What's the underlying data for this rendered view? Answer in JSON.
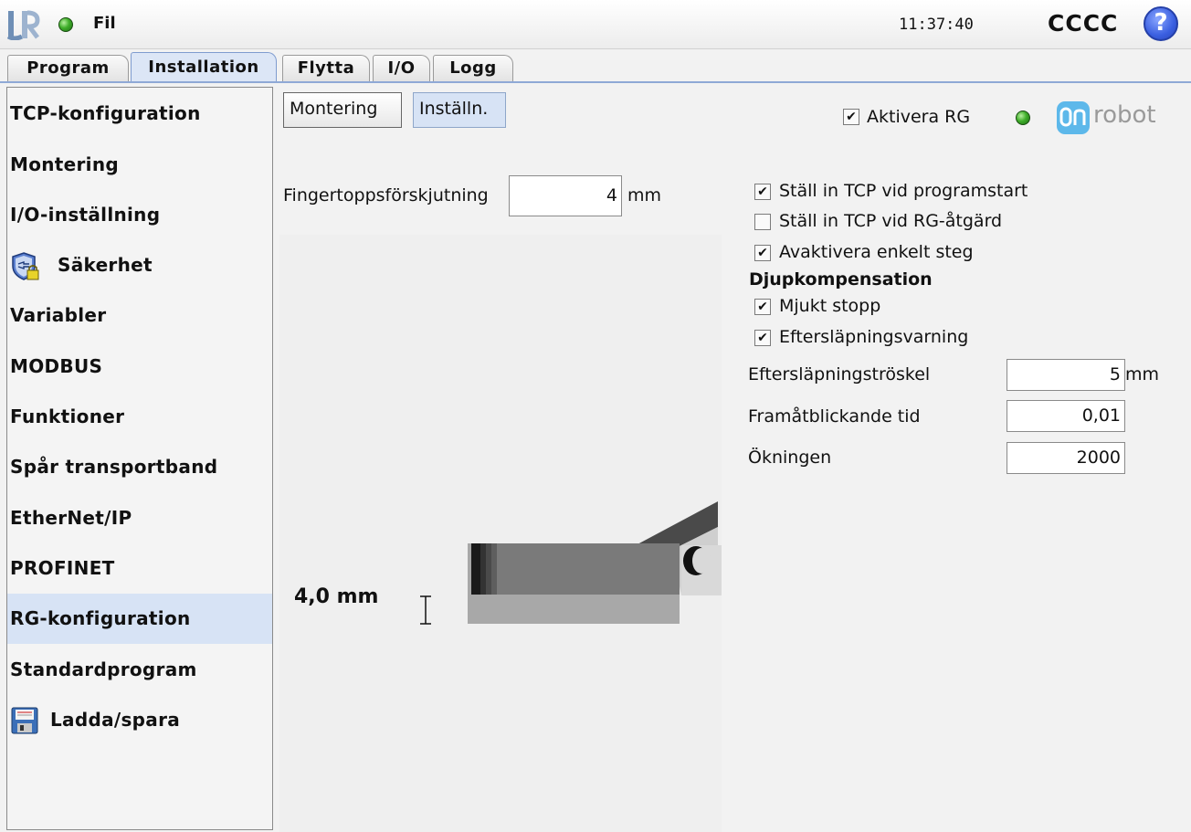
{
  "topbar": {
    "file_menu": "Fil",
    "clock": "11:37:40",
    "robot_name": "CCCC",
    "help_label": "?"
  },
  "tabs": [
    {
      "label": "Program"
    },
    {
      "label": "Installation"
    },
    {
      "label": "Flytta"
    },
    {
      "label": "I/O"
    },
    {
      "label": "Logg"
    }
  ],
  "sidebar": {
    "items": [
      {
        "label": "TCP-konfiguration"
      },
      {
        "label": "Montering"
      },
      {
        "label": "I/O-inställning"
      },
      {
        "label": "Säkerhet"
      },
      {
        "label": "Variabler"
      },
      {
        "label": "MODBUS"
      },
      {
        "label": "Funktioner"
      },
      {
        "label": "Spår transportband"
      },
      {
        "label": "EtherNet/IP"
      },
      {
        "label": "PROFINET"
      },
      {
        "label": "RG-konfiguration"
      },
      {
        "label": "Standardprogram"
      },
      {
        "label": "Ladda/spara"
      }
    ]
  },
  "content": {
    "buttons": {
      "mounting": "Montering",
      "settings": "Inställn."
    },
    "activate_rg": {
      "label": "Aktivera RG",
      "checked": "✔"
    },
    "brand": "robot",
    "fingertip": {
      "label": "Fingertoppsförskjutning",
      "value": "4",
      "unit": "mm"
    },
    "options": [
      {
        "label": "Ställ in TCP vid programstart",
        "mark": "✔"
      },
      {
        "label": "Ställ in TCP vid RG-åtgärd",
        "mark": ""
      },
      {
        "label": "Avaktivera enkelt steg",
        "mark": "✔"
      }
    ],
    "depth": {
      "heading": "Djupkompensation",
      "options": [
        {
          "label": "Mjukt stopp",
          "mark": "✔"
        },
        {
          "label": "Eftersläpningsvarning",
          "mark": "✔"
        }
      ],
      "lag_threshold": {
        "label": "Eftersläpningströskel",
        "value": "5",
        "unit": "mm"
      },
      "lookahead": {
        "label": "Framåtblickande tid",
        "value": "0,01"
      },
      "gain": {
        "label": "Ökningen",
        "value": "2000"
      }
    },
    "depth_readout": "4,0 mm"
  }
}
